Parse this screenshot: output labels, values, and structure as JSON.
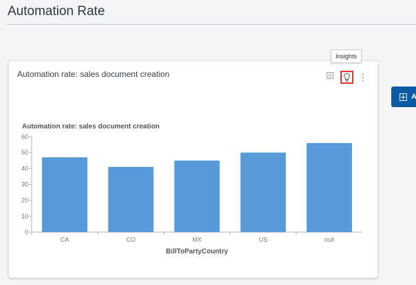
{
  "page": {
    "title": "Automation Rate"
  },
  "card": {
    "title": "Automation rate: sales document creation",
    "tooltip": "Insights",
    "icons": [
      "expand-icon",
      "lightbulb-icon",
      "more-vertical-icon"
    ]
  },
  "side_button": {
    "label": "A",
    "icon": "plus-box-icon"
  },
  "colors": {
    "bar": "#5899da",
    "accent_button": "#0a5aa3",
    "highlight": "#e3312d"
  },
  "chart_data": {
    "type": "bar",
    "title": "Automation rate: sales document creation",
    "xlabel": "BillToPartyCountry",
    "ylabel": "",
    "categories": [
      "CA",
      "CO",
      "MX",
      "US",
      "null"
    ],
    "values": [
      47,
      41,
      45,
      50,
      56
    ],
    "ylim": [
      0,
      60
    ],
    "yticks": [
      0,
      10,
      20,
      30,
      40,
      50,
      60
    ],
    "grid": false,
    "legend": "none"
  }
}
